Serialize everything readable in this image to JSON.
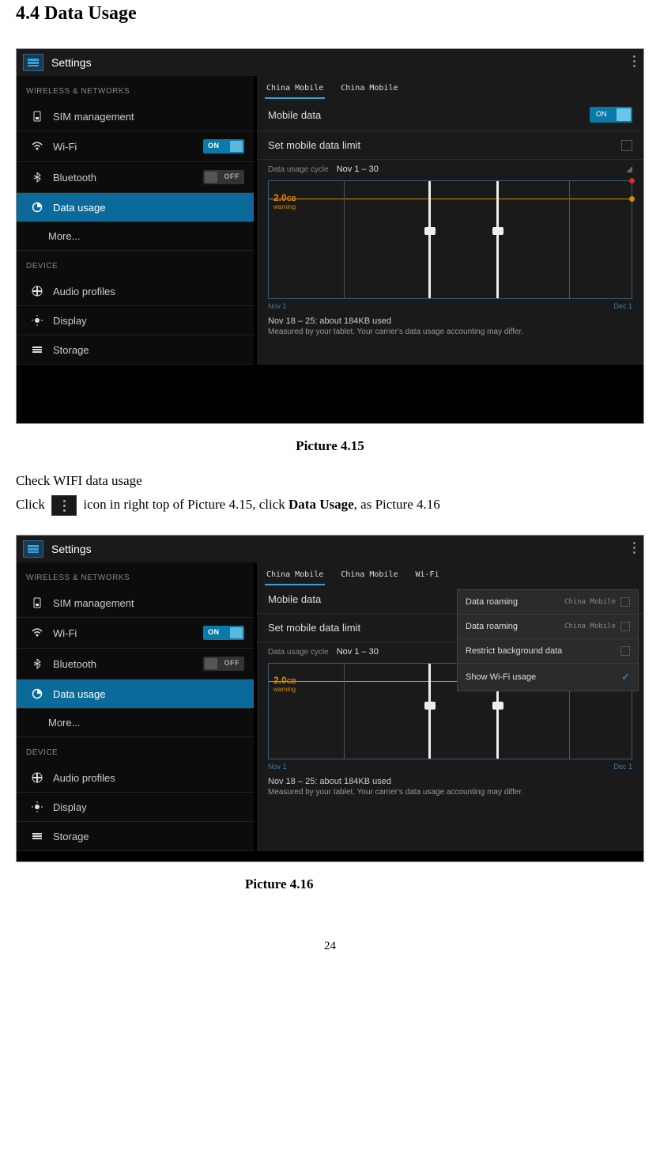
{
  "heading": "4.4 Data Usage",
  "caption1": "Picture 4.15",
  "para_check": "Check WIFI data usage",
  "para_click_a": "Click ",
  "para_click_b": " icon in right top of Picture 4.15, click ",
  "para_click_bold": "Data Usage",
  "para_click_c": ", as Picture 4.16",
  "caption2": "Picture 4.16",
  "page_number": "24",
  "screens": {
    "s1": {
      "title": "Settings",
      "section_wireless": "WIRELESS & NETWORKS",
      "section_device": "DEVICE",
      "nav": {
        "sim": "SIM management",
        "wifi": "Wi-Fi",
        "bt": "Bluetooth",
        "data": "Data usage",
        "more": "More...",
        "audio": "Audio profiles",
        "display": "Display",
        "storage": "Storage"
      },
      "toggles": {
        "on": "ON",
        "off": "OFF"
      },
      "tabs": {
        "t1": "China Mobile",
        "t2": "China Mobile"
      },
      "rows": {
        "mobile_data": "Mobile data",
        "set_limit": "Set mobile data limit",
        "cycle_label": "Data usage cycle",
        "cycle_value": "Nov 1 – 30"
      },
      "chart": {
        "warn_val": "2.0",
        "warn_unit": "GB",
        "warn_word": "warning",
        "axis_left": "Nov 1",
        "axis_right": "Dec 1"
      },
      "usage": "Nov 18 – 25: about 184KB used",
      "disclaimer": "Measured by your tablet. Your carrier's data usage accounting may differ."
    },
    "s2": {
      "title": "Settings",
      "section_wireless": "WIRELESS & NETWORKS",
      "section_device": "DEVICE",
      "nav": {
        "sim": "SIM management",
        "wifi": "Wi-Fi",
        "bt": "Bluetooth",
        "data": "Data usage",
        "more": "More...",
        "audio": "Audio profiles",
        "display": "Display",
        "storage": "Storage"
      },
      "toggles": {
        "on": "ON",
        "off": "OFF"
      },
      "tabs": {
        "t1": "China Mobile",
        "t2": "China Mobile",
        "t3": "Wi-Fi"
      },
      "rows": {
        "mobile_data": "Mobile data",
        "set_limit": "Set mobile data limit",
        "cycle_label": "Data usage cycle",
        "cycle_value": "Nov 1 – 30"
      },
      "chart": {
        "warn_val": "2.0",
        "warn_unit": "GB",
        "warn_word": "warning",
        "axis_left": "Nov 1",
        "axis_right": "Dec 1"
      },
      "usage": "Nov 18 – 25: about 184KB used",
      "disclaimer": "Measured by your tablet. Your carrier's data usage accounting may differ.",
      "menu": {
        "m1": "Data roaming",
        "m1s": "China Mobile",
        "m2": "Data roaming",
        "m2s": "China Mobile",
        "m3": "Restrict background data",
        "m4": "Show Wi-Fi usage"
      }
    }
  }
}
